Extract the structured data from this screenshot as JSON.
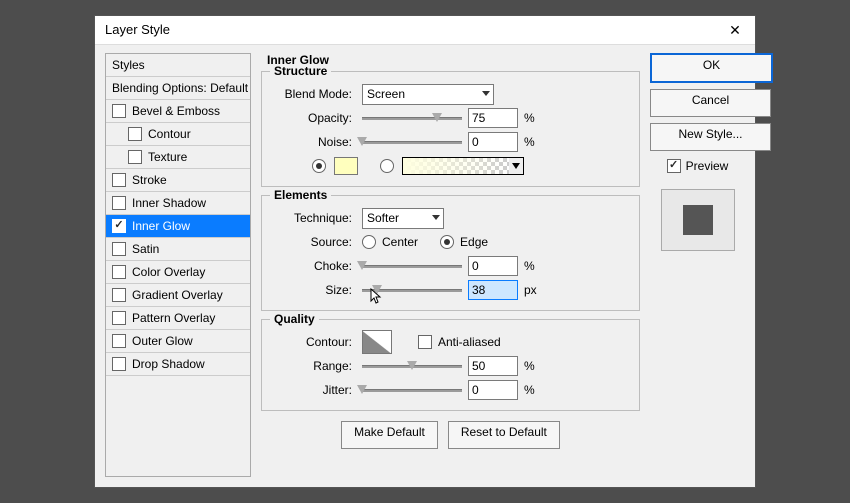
{
  "window": {
    "title": "Layer Style"
  },
  "sidebar": {
    "header": "Styles",
    "blending": "Blending Options: Default",
    "items": [
      {
        "label": "Bevel & Emboss",
        "checked": false,
        "indent": false
      },
      {
        "label": "Contour",
        "checked": false,
        "indent": true
      },
      {
        "label": "Texture",
        "checked": false,
        "indent": true
      },
      {
        "label": "Stroke",
        "checked": false,
        "indent": false
      },
      {
        "label": "Inner Shadow",
        "checked": false,
        "indent": false
      },
      {
        "label": "Inner Glow",
        "checked": true,
        "indent": false,
        "selected": true
      },
      {
        "label": "Satin",
        "checked": false,
        "indent": false
      },
      {
        "label": "Color Overlay",
        "checked": false,
        "indent": false
      },
      {
        "label": "Gradient Overlay",
        "checked": false,
        "indent": false
      },
      {
        "label": "Pattern Overlay",
        "checked": false,
        "indent": false
      },
      {
        "label": "Outer Glow",
        "checked": false,
        "indent": false
      },
      {
        "label": "Drop Shadow",
        "checked": false,
        "indent": false
      }
    ]
  },
  "panel_heading": "Inner Glow",
  "structure": {
    "title": "Structure",
    "blend_mode_label": "Blend Mode:",
    "blend_mode_value": "Screen",
    "opacity_label": "Opacity:",
    "opacity_value": "75",
    "opacity_unit": "%",
    "noise_label": "Noise:",
    "noise_value": "0",
    "noise_unit": "%",
    "color_swatch": "#ffffbe"
  },
  "elements": {
    "title": "Elements",
    "technique_label": "Technique:",
    "technique_value": "Softer",
    "source_label": "Source:",
    "source_center": "Center",
    "source_edge": "Edge",
    "choke_label": "Choke:",
    "choke_value": "0",
    "choke_unit": "%",
    "size_label": "Size:",
    "size_value": "38",
    "size_unit": "px"
  },
  "quality": {
    "title": "Quality",
    "contour_label": "Contour:",
    "anti_aliased": "Anti-aliased",
    "range_label": "Range:",
    "range_value": "50",
    "range_unit": "%",
    "jitter_label": "Jitter:",
    "jitter_value": "0",
    "jitter_unit": "%"
  },
  "bottom": {
    "make_default": "Make Default",
    "reset_default": "Reset to Default"
  },
  "right": {
    "ok": "OK",
    "cancel": "Cancel",
    "new_style": "New Style...",
    "preview": "Preview"
  }
}
